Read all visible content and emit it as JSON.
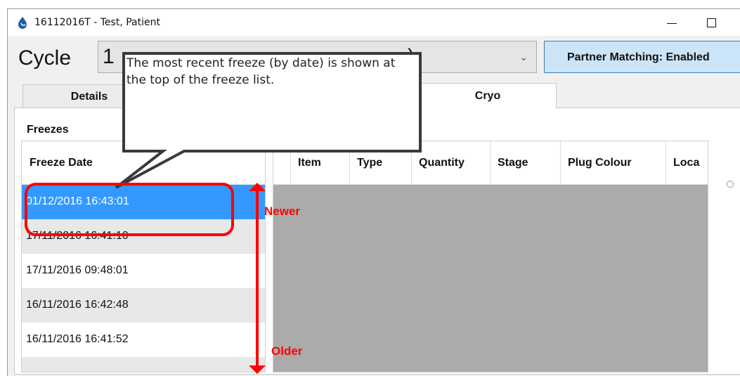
{
  "window": {
    "title": "16112016T - Test, Patient"
  },
  "cycle": {
    "label": "Cycle",
    "selected_value_visible": "1",
    "selected_value_tail": ")"
  },
  "partner_matching": {
    "label": "Partner Matching: Enabled"
  },
  "tabs": [
    {
      "label": "Details"
    },
    {
      "label": "Cryo",
      "active": true
    }
  ],
  "freezes": {
    "section_label": "Freezes",
    "column_header": "Freeze Date",
    "rows": [
      {
        "date": "01/12/2016 16:43:01",
        "selected": true
      },
      {
        "date": "17/11/2016 16:41:10"
      },
      {
        "date": "17/11/2016 09:48:01"
      },
      {
        "date": "16/11/2016 16:42:48"
      },
      {
        "date": "16/11/2016 16:41:52"
      }
    ]
  },
  "detail_grid": {
    "columns": [
      "Item",
      "Type",
      "Quantity",
      "Stage",
      "Plug Colour",
      "Loca"
    ]
  },
  "annotation": {
    "callout": "The most recent freeze (by date) is shown at the top of the freeze list.",
    "newer_label": "Newer",
    "older_label": "Older",
    "accent_color": "#ff0000"
  }
}
